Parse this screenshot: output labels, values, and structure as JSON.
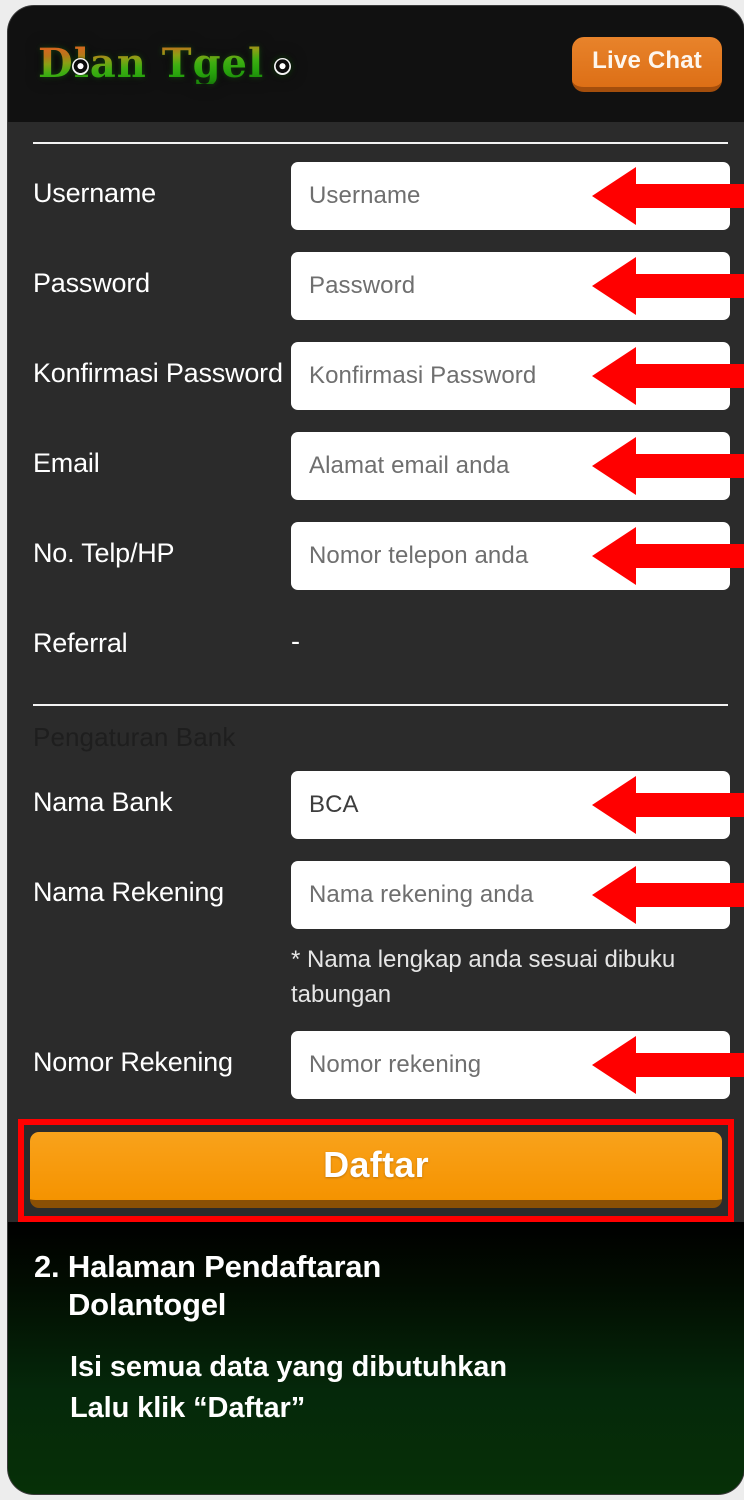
{
  "header": {
    "brand_part_1": "D",
    "brand_part_2": "lan T",
    "brand_part_3": "gel",
    "brand_full": "Dolan Togel",
    "live_chat_label": "Live Chat"
  },
  "form": {
    "fields": [
      {
        "label": "Username",
        "value": "Username",
        "state": "placeholder",
        "arrow": true
      },
      {
        "label": "Password",
        "value": "Password",
        "state": "placeholder",
        "arrow": true
      },
      {
        "label": "Konfirmasi Password",
        "value": "Konfirmasi Password",
        "state": "placeholder",
        "arrow": true
      },
      {
        "label": "Email",
        "value": "Alamat email anda",
        "state": "placeholder",
        "arrow": true
      },
      {
        "label": "No. Telp/HP",
        "value": "Nomor telepon anda",
        "state": "placeholder",
        "arrow": true
      },
      {
        "label": "Referral",
        "value": "-",
        "state": "static",
        "arrow": false
      }
    ],
    "bank_section_title": "Pengaturan Bank",
    "bank_fields": [
      {
        "label": "Nama Bank",
        "value": "BCA",
        "state": "filled",
        "arrow": true
      },
      {
        "label": "Nama Rekening",
        "value": "Nama rekening anda",
        "state": "placeholder",
        "arrow": true
      },
      {
        "label": "Nomor Rekening",
        "value": "Nomor rekening",
        "state": "placeholder",
        "arrow": true
      }
    ],
    "helper_note": "* Nama lengkap anda sesuai dibuku tabungan",
    "submit_label": "Daftar"
  },
  "caption": {
    "step_number": "2.",
    "title": "Halaman Pendaftaran",
    "title_line2": "Dolantogel",
    "line_1": "Isi semua data yang dibutuhkan",
    "line_2": "Lalu klik “Daftar”"
  },
  "colors": {
    "accent_orange": "#f59300",
    "live_chat_orange": "#e2761f",
    "annotation_red": "#ff0000",
    "card_background": "#2b2b2b",
    "header_background": "#111111",
    "caption_green": "#063007"
  }
}
